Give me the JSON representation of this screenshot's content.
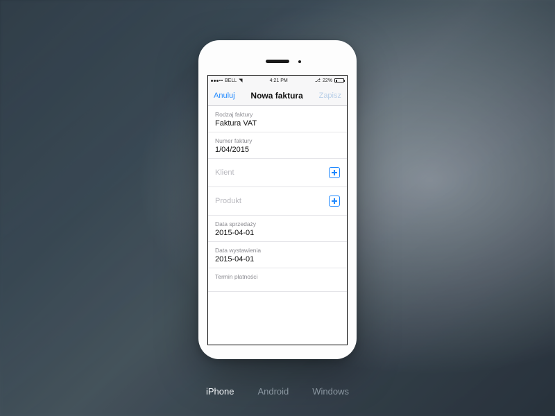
{
  "status": {
    "carrier": "BELL",
    "time": "4:21 PM",
    "battery": "22%"
  },
  "nav": {
    "cancel": "Anuluj",
    "title": "Nowa faktura",
    "save": "Zapisz"
  },
  "fields": {
    "type": {
      "label": "Rodzaj faktury",
      "value": "Faktura VAT"
    },
    "number": {
      "label": "Numer faktury",
      "value": "1/04/2015"
    },
    "client": {
      "label": "Klient"
    },
    "product": {
      "label": "Produkt"
    },
    "sale_date": {
      "label": "Data sprzedaży",
      "value": "2015-04-01"
    },
    "issue_date": {
      "label": "Data wystawienia",
      "value": "2015-04-01"
    },
    "due_date": {
      "label": "Termin płatności"
    }
  },
  "platforms": {
    "iphone": "iPhone",
    "android": "Android",
    "windows": "Windows"
  }
}
